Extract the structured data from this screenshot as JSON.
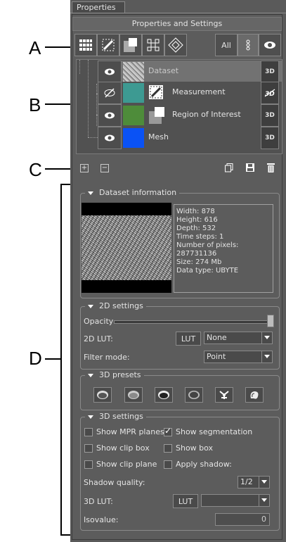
{
  "tab": {
    "label": "Properties"
  },
  "header": {
    "title": "Properties and Settings"
  },
  "toolbar": {
    "all_label": "All",
    "icons": [
      "grid-icon",
      "measure-ruler-icon",
      "region-icon",
      "mesh-icon",
      "volume-icon"
    ]
  },
  "annotations": {
    "a": "A",
    "b": "B",
    "c": "C",
    "d": "D"
  },
  "tree": {
    "items": [
      {
        "label": "Dataset",
        "badge": "3D",
        "visible": true
      },
      {
        "label": "Measurement",
        "badge": "3D",
        "visible": false
      },
      {
        "label": "Region of Interest",
        "badge": "3D",
        "visible": true
      },
      {
        "label": "Mesh",
        "badge": "3D",
        "visible": true
      }
    ],
    "colors": {
      "measurement": "#3d9a92",
      "region": "#4e8c3a",
      "mesh": "#0a52f5"
    }
  },
  "dataset_info": {
    "title": "Dataset information",
    "lines": [
      "Width: 878",
      "Height: 616",
      "Depth: 532",
      "Time steps: 1",
      "Number of pixels:",
      "287731136",
      "Size: 274 Mb",
      "Data type: UBYTE"
    ]
  },
  "settings_2d": {
    "title": "2D settings",
    "opacity_label": "Opacity",
    "opacity_value": 1.0,
    "lut_label": "2D LUT:",
    "lut_button": "LUT",
    "lut_value": "None",
    "filter_label": "Filter mode:",
    "filter_value": "Point"
  },
  "presets_3d": {
    "title": "3D presets",
    "icons": [
      "preset-skin-icon",
      "preset-bone-icon",
      "preset-dark-icon",
      "preset-soft-icon",
      "preset-skeleton-icon",
      "preset-vessel-icon"
    ]
  },
  "settings_3d": {
    "title": "3D settings",
    "show_mpr": "Show MPR planes",
    "show_seg": "Show segmentation",
    "show_clip_box": "Show clip box",
    "show_box": "Show box",
    "show_clip_plane": "Show clip plane",
    "apply_shadow": "Apply shadow:",
    "shadow_quality_label": "Shadow quality:",
    "shadow_quality_value": "1/2",
    "lut_label": "3D LUT:",
    "lut_button": "LUT",
    "lut_value": "",
    "isovalue_label": "Isovalue:",
    "isovalue_value": "0"
  }
}
